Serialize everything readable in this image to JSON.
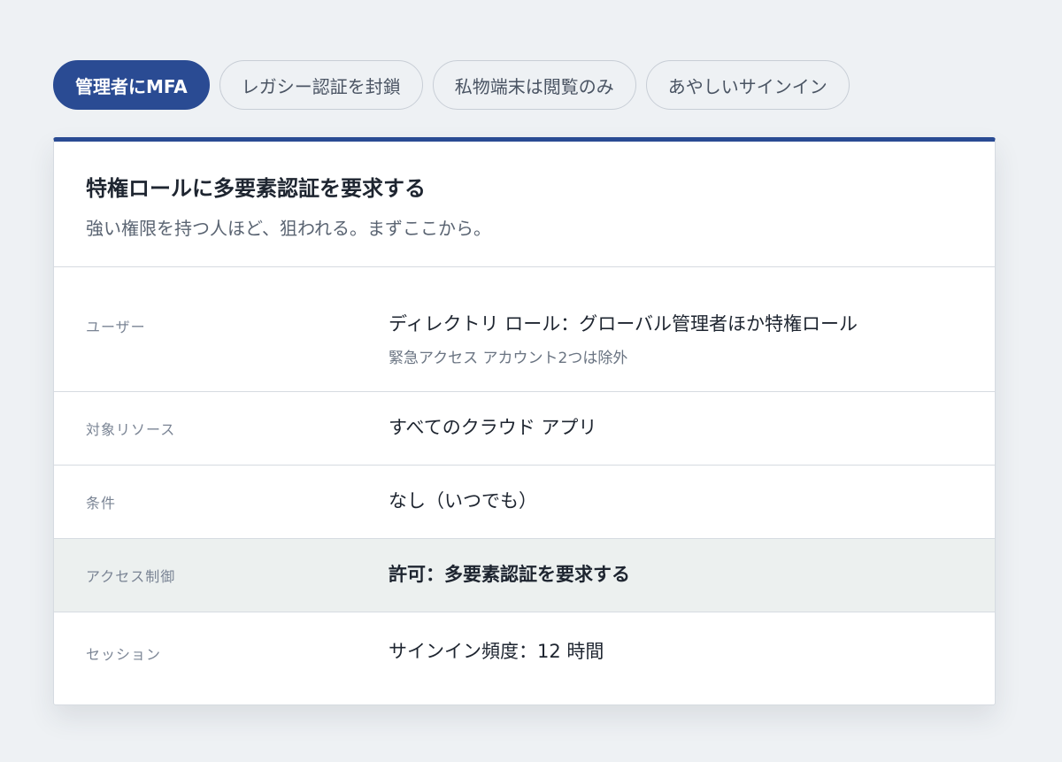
{
  "tabs": [
    {
      "label": "管理者にMFA",
      "active": true
    },
    {
      "label": "レガシー認証を封鎖",
      "active": false
    },
    {
      "label": "私物端末は閲覧のみ",
      "active": false
    },
    {
      "label": "あやしいサインイン",
      "active": false
    }
  ],
  "accent_color": "#2a4b93",
  "policy": {
    "title": "特権ロールに多要素認証を要求する",
    "subtitle": "強い権限を持つ人ほど、狙われる。まずここから。",
    "rows": {
      "users": {
        "label": "ユーザー",
        "value": "ディレクトリ ロール：グローバル管理者ほか特権ロール",
        "note": "緊急アクセス アカウント2つは除外"
      },
      "resources": {
        "label": "対象リソース",
        "value": "すべてのクラウド アプリ"
      },
      "conditions": {
        "label": "条件",
        "value": "なし（いつでも）"
      },
      "access_control": {
        "label": "アクセス制御",
        "value": "許可：多要素認証を要求する"
      },
      "session": {
        "label": "セッション",
        "value": "サインイン頻度：12 時間"
      }
    }
  }
}
